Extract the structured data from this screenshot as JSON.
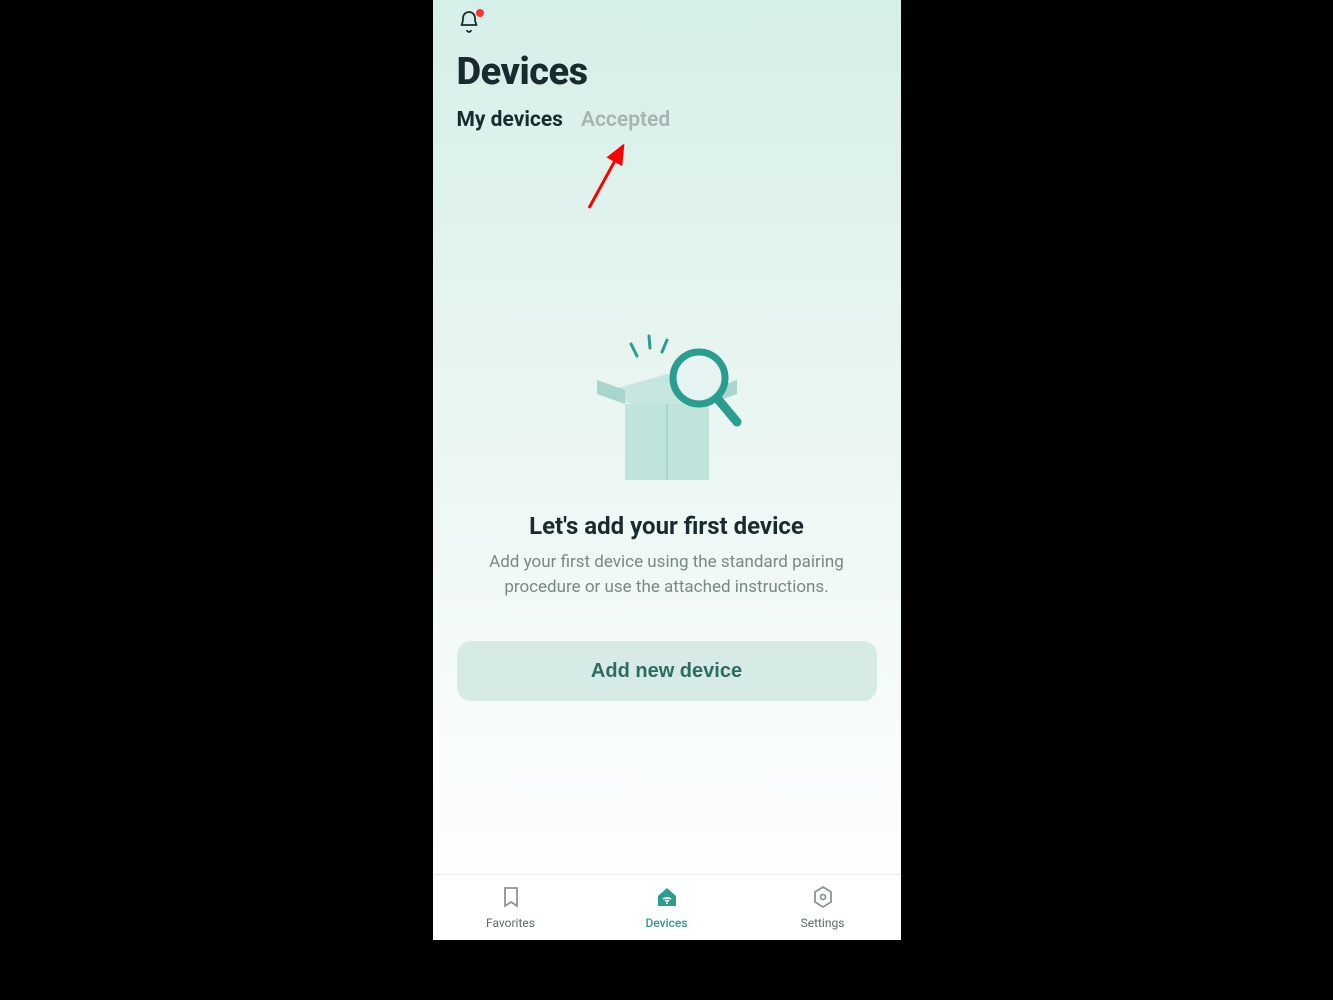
{
  "header": {
    "title": "Devices",
    "has_notification_dot": true
  },
  "tabs": {
    "my_devices": "My devices",
    "accepted": "Accepted"
  },
  "empty_state": {
    "title": "Let's add your first device",
    "body": "Add your first device using the standard pairing procedure or use the attached instructions.",
    "button": "Add new device"
  },
  "nav": {
    "favorites": "Favorites",
    "devices": "Devices",
    "settings": "Settings",
    "active": "devices"
  },
  "colors": {
    "accent": "#2a9d8f",
    "arrow": "#ff0000"
  }
}
